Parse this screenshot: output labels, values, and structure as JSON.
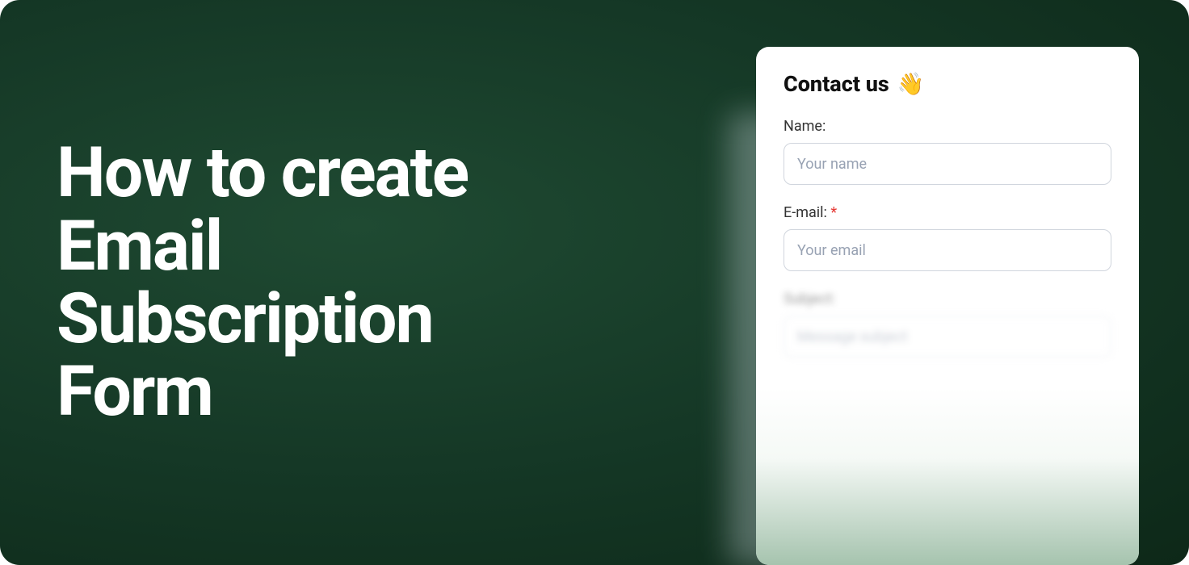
{
  "headline": "How to create Email Subscription Form",
  "form": {
    "title": "Contact us",
    "emoji": "👋",
    "fields": {
      "name": {
        "label": "Name:",
        "placeholder": "Your name",
        "required": false
      },
      "email": {
        "label": "E-mail:",
        "required_marker": "*",
        "placeholder": "Your email",
        "required": true
      },
      "subject": {
        "label": "Subject:",
        "placeholder": "Message subject",
        "required": false
      }
    }
  }
}
